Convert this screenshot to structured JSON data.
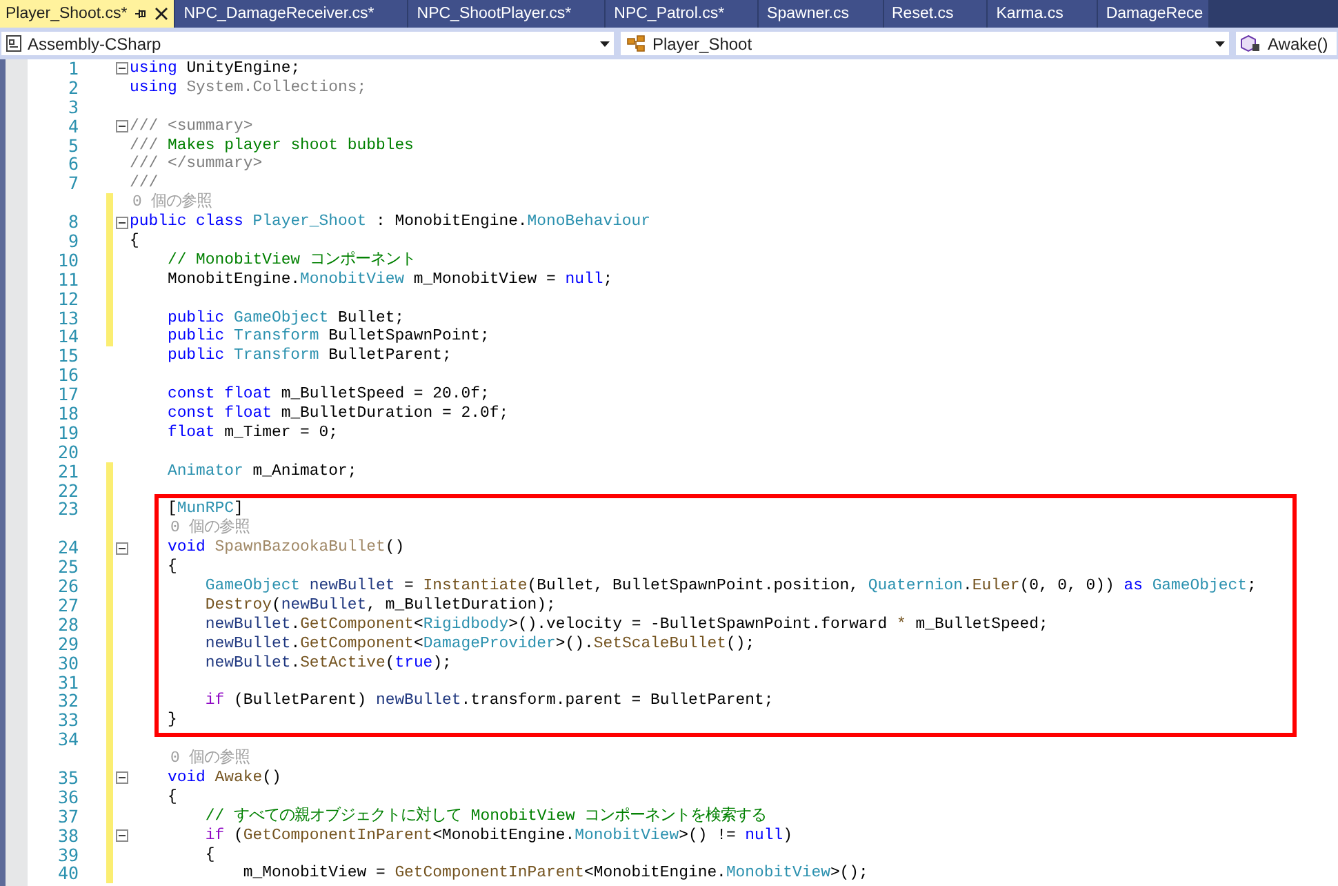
{
  "tabs": [
    {
      "label": "Player_Shoot.cs*",
      "selected": true,
      "pinned": true
    },
    {
      "label": "NPC_DamageReceiver.cs*",
      "selected": false,
      "pinned": false
    },
    {
      "label": "NPC_ShootPlayer.cs*",
      "selected": false,
      "pinned": false
    },
    {
      "label": "NPC_Patrol.cs*",
      "selected": false,
      "pinned": false
    },
    {
      "label": "Spawner.cs",
      "selected": false,
      "pinned": false
    },
    {
      "label": "Reset.cs",
      "selected": false,
      "pinned": false
    },
    {
      "label": "Karma.cs",
      "selected": false,
      "pinned": false
    },
    {
      "label": "DamageRece",
      "selected": false,
      "pinned": false
    }
  ],
  "navigation_bar": {
    "project": "Assembly-CSharp",
    "type": "Player_Shoot",
    "member": "Awake()"
  },
  "sections": [
    {
      "highlighted": false,
      "lines": [
        {
          "kind": "code",
          "number": "1",
          "fold": true,
          "changed": false,
          "tokens": [
            {
              "kind": "keyword",
              "text": "using"
            },
            {
              "kind": "plain",
              "text": " UnityEngine;"
            }
          ]
        },
        {
          "kind": "code",
          "number": "2",
          "fold": false,
          "changed": false,
          "tokens": [
            {
              "kind": "keyword",
              "text": "using"
            },
            {
              "kind": "doc",
              "text": " System.Collections;"
            }
          ]
        },
        {
          "kind": "code",
          "number": "3",
          "fold": false,
          "changed": false
        },
        {
          "kind": "code",
          "number": "4",
          "fold": true,
          "changed": false,
          "tokens": [
            {
              "kind": "doc",
              "text": "/// <summary>"
            }
          ]
        },
        {
          "kind": "code",
          "number": "5",
          "fold": false,
          "changed": false,
          "tokens": [
            {
              "kind": "doc",
              "text": "/// "
            },
            {
              "kind": "comment",
              "text": "Makes player shoot bubbles"
            }
          ]
        },
        {
          "kind": "code",
          "number": "6",
          "fold": false,
          "changed": false,
          "tokens": [
            {
              "kind": "doc",
              "text": "/// </summary>"
            }
          ]
        },
        {
          "kind": "code",
          "number": "7",
          "fold": false,
          "changed": false,
          "tokens": [
            {
              "kind": "doc",
              "text": "///"
            }
          ]
        },
        {
          "kind": "lens",
          "text": "0 個の参照",
          "changed": true
        },
        {
          "kind": "code",
          "number": "8",
          "fold": true,
          "changed": true,
          "tokens": [
            {
              "kind": "keyword",
              "text": "public class "
            },
            {
              "kind": "type",
              "text": "Player_Shoot"
            },
            {
              "kind": "plain",
              "text": " : MonobitEngine."
            },
            {
              "kind": "type",
              "text": "MonoBehaviour"
            }
          ]
        },
        {
          "kind": "code",
          "number": "9",
          "fold": false,
          "changed": true,
          "tokens": [
            {
              "kind": "plain",
              "text": "{"
            }
          ]
        },
        {
          "kind": "code",
          "number": "10",
          "fold": false,
          "changed": true,
          "tokens": [
            {
              "kind": "comment",
              "text": "    // MonobitView コンポーネント"
            }
          ]
        },
        {
          "kind": "code",
          "number": "11",
          "fold": false,
          "changed": true,
          "tokens": [
            {
              "kind": "plain",
              "text": "    MonobitEngine."
            },
            {
              "kind": "type",
              "text": "MonobitView"
            },
            {
              "kind": "plain",
              "text": " m_MonobitView = "
            },
            {
              "kind": "keyword",
              "text": "null"
            },
            {
              "kind": "plain",
              "text": ";"
            }
          ]
        },
        {
          "kind": "code",
          "number": "12",
          "fold": false,
          "changed": true
        },
        {
          "kind": "code",
          "number": "13",
          "fold": false,
          "changed": true,
          "tokens": [
            {
              "kind": "keyword",
              "text": "    public "
            },
            {
              "kind": "type",
              "text": "GameObject"
            },
            {
              "kind": "plain",
              "text": " Bullet;"
            }
          ]
        },
        {
          "kind": "code",
          "number": "14",
          "fold": false,
          "changed": true,
          "tokens": [
            {
              "kind": "keyword",
              "text": "    public "
            },
            {
              "kind": "type",
              "text": "Transform"
            },
            {
              "kind": "plain",
              "text": " BulletSpawnPoint;"
            }
          ]
        },
        {
          "kind": "code",
          "number": "15",
          "fold": false,
          "changed": false,
          "tokens": [
            {
              "kind": "keyword",
              "text": "    public "
            },
            {
              "kind": "type",
              "text": "Transform"
            },
            {
              "kind": "plain",
              "text": " BulletParent;"
            }
          ]
        },
        {
          "kind": "code",
          "number": "16",
          "fold": false,
          "changed": false
        },
        {
          "kind": "code",
          "number": "17",
          "fold": false,
          "changed": false,
          "tokens": [
            {
              "kind": "keyword",
              "text": "    const float"
            },
            {
              "kind": "plain",
              "text": " m_BulletSpeed = 20.0f;"
            }
          ]
        },
        {
          "kind": "code",
          "number": "18",
          "fold": false,
          "changed": false,
          "tokens": [
            {
              "kind": "keyword",
              "text": "    const float"
            },
            {
              "kind": "plain",
              "text": " m_BulletDuration = 2.0f;"
            }
          ]
        },
        {
          "kind": "code",
          "number": "19",
          "fold": false,
          "changed": false,
          "tokens": [
            {
              "kind": "keyword",
              "text": "    float"
            },
            {
              "kind": "plain",
              "text": " m_Timer = 0;"
            }
          ]
        },
        {
          "kind": "code",
          "number": "20",
          "fold": false,
          "changed": false
        },
        {
          "kind": "code",
          "number": "21",
          "fold": false,
          "changed": true,
          "tokens": [
            {
              "kind": "type",
              "text": "    Animator"
            },
            {
              "kind": "plain",
              "text": " m_Animator;"
            }
          ]
        },
        {
          "kind": "code",
          "number": "22",
          "fold": false,
          "changed": true
        }
      ]
    },
    {
      "highlighted": true,
      "lines": [
        {
          "kind": "code",
          "number": "23",
          "fold": false,
          "changed": true,
          "tokens": [
            {
              "kind": "plain",
              "text": "    ["
            },
            {
              "kind": "type",
              "text": "MunRPC"
            },
            {
              "kind": "plain",
              "text": "]"
            }
          ]
        },
        {
          "kind": "lens",
          "text": "0 個の参照",
          "changed": true
        },
        {
          "kind": "code",
          "number": "24",
          "fold": true,
          "changed": true,
          "tokens": [
            {
              "kind": "keyword",
              "text": "    void "
            },
            {
              "kind": "unused",
              "text": "SpawnBazookaBullet"
            },
            {
              "kind": "plain",
              "text": "()"
            }
          ]
        },
        {
          "kind": "code",
          "number": "25",
          "fold": false,
          "changed": true,
          "tokens": [
            {
              "kind": "plain",
              "text": "    {"
            }
          ]
        },
        {
          "kind": "code",
          "number": "26",
          "fold": false,
          "changed": true,
          "tokens": [
            {
              "kind": "type",
              "text": "        GameObject"
            },
            {
              "kind": "local",
              "text": " newBullet"
            },
            {
              "kind": "plain",
              "text": " = "
            },
            {
              "kind": "method",
              "text": "Instantiate"
            },
            {
              "kind": "plain",
              "text": "(Bullet, BulletSpawnPoint.position, "
            },
            {
              "kind": "type",
              "text": "Quaternion"
            },
            {
              "kind": "plain",
              "text": "."
            },
            {
              "kind": "method",
              "text": "Euler"
            },
            {
              "kind": "plain",
              "text": "(0, 0, 0)) "
            },
            {
              "kind": "keyword",
              "text": "as"
            },
            {
              "kind": "type",
              "text": " GameObject"
            },
            {
              "kind": "plain",
              "text": ";"
            }
          ]
        },
        {
          "kind": "code",
          "number": "27",
          "fold": false,
          "changed": true,
          "tokens": [
            {
              "kind": "method",
              "text": "        Destroy"
            },
            {
              "kind": "plain",
              "text": "("
            },
            {
              "kind": "local",
              "text": "newBullet"
            },
            {
              "kind": "plain",
              "text": ", m_BulletDuration);"
            }
          ]
        },
        {
          "kind": "code",
          "number": "28",
          "fold": false,
          "changed": true,
          "tokens": [
            {
              "kind": "local",
              "text": "        newBullet"
            },
            {
              "kind": "plain",
              "text": "."
            },
            {
              "kind": "method",
              "text": "GetComponent"
            },
            {
              "kind": "plain",
              "text": "<"
            },
            {
              "kind": "type",
              "text": "Rigidbody"
            },
            {
              "kind": "plain",
              "text": ">().velocity = -BulletSpawnPoint.forward "
            },
            {
              "kind": "method",
              "text": "*"
            },
            {
              "kind": "plain",
              "text": " m_BulletSpeed;"
            }
          ]
        },
        {
          "kind": "code",
          "number": "29",
          "fold": false,
          "changed": true,
          "tokens": [
            {
              "kind": "local",
              "text": "        newBullet"
            },
            {
              "kind": "plain",
              "text": "."
            },
            {
              "kind": "method",
              "text": "GetComponent"
            },
            {
              "kind": "plain",
              "text": "<"
            },
            {
              "kind": "type",
              "text": "DamageProvider"
            },
            {
              "kind": "plain",
              "text": ">()."
            },
            {
              "kind": "method",
              "text": "SetScaleBullet"
            },
            {
              "kind": "plain",
              "text": "();"
            }
          ]
        },
        {
          "kind": "code",
          "number": "30",
          "fold": false,
          "changed": true,
          "tokens": [
            {
              "kind": "local",
              "text": "        newBullet"
            },
            {
              "kind": "plain",
              "text": "."
            },
            {
              "kind": "method",
              "text": "SetActive"
            },
            {
              "kind": "plain",
              "text": "("
            },
            {
              "kind": "keyword",
              "text": "true"
            },
            {
              "kind": "plain",
              "text": ");"
            }
          ]
        },
        {
          "kind": "code",
          "number": "31",
          "fold": false,
          "changed": true
        },
        {
          "kind": "code",
          "number": "32",
          "fold": false,
          "changed": true,
          "tokens": [
            {
              "kind": "control",
              "text": "        if"
            },
            {
              "kind": "plain",
              "text": " (BulletParent) "
            },
            {
              "kind": "local",
              "text": "newBullet"
            },
            {
              "kind": "plain",
              "text": ".transform.parent = BulletParent;"
            }
          ]
        },
        {
          "kind": "code",
          "number": "33",
          "fold": false,
          "changed": true,
          "tokens": [
            {
              "kind": "plain",
              "text": "    }"
            }
          ]
        }
      ]
    },
    {
      "highlighted": false,
      "lines": [
        {
          "kind": "code",
          "number": "34",
          "fold": false,
          "changed": true
        },
        {
          "kind": "lens",
          "text": "0 個の参照",
          "changed": true
        },
        {
          "kind": "code",
          "number": "35",
          "fold": true,
          "changed": true,
          "tokens": [
            {
              "kind": "keyword",
              "text": "    void "
            },
            {
              "kind": "method",
              "text": "Awake"
            },
            {
              "kind": "plain",
              "text": "()"
            }
          ]
        },
        {
          "kind": "code",
          "number": "36",
          "fold": false,
          "changed": true,
          "tokens": [
            {
              "kind": "plain",
              "text": "    {"
            }
          ]
        },
        {
          "kind": "code",
          "number": "37",
          "fold": false,
          "changed": true,
          "tokens": [
            {
              "kind": "comment",
              "text": "        // すべての親オブジェクトに対して MonobitView コンポーネントを検索する"
            }
          ]
        },
        {
          "kind": "code",
          "number": "38",
          "fold": true,
          "changed": true,
          "tokens": [
            {
              "kind": "control",
              "text": "        if"
            },
            {
              "kind": "plain",
              "text": " ("
            },
            {
              "kind": "method",
              "text": "GetComponentInParent"
            },
            {
              "kind": "plain",
              "text": "<MonobitEngine."
            },
            {
              "kind": "type",
              "text": "MonobitView"
            },
            {
              "kind": "plain",
              "text": ">() != "
            },
            {
              "kind": "keyword",
              "text": "null"
            },
            {
              "kind": "plain",
              "text": ")"
            }
          ]
        },
        {
          "kind": "code",
          "number": "39",
          "fold": false,
          "changed": true,
          "tokens": [
            {
              "kind": "plain",
              "text": "        {"
            }
          ]
        },
        {
          "kind": "code",
          "number": "40",
          "fold": false,
          "changed": true,
          "tokens": [
            {
              "kind": "plain",
              "text": "            m_MonobitView = "
            },
            {
              "kind": "method",
              "text": "GetComponentInParent"
            },
            {
              "kind": "plain",
              "text": "<MonobitEngine."
            },
            {
              "kind": "type",
              "text": "MonobitView"
            },
            {
              "kind": "plain",
              "text": ">();"
            }
          ]
        }
      ]
    }
  ]
}
